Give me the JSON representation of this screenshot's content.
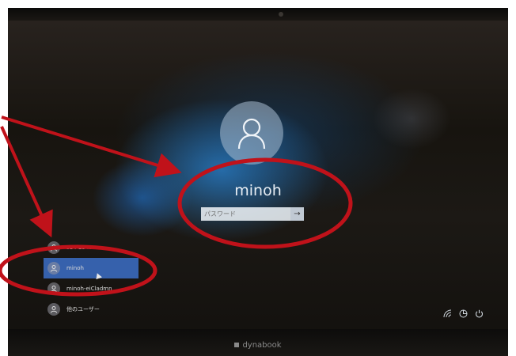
{
  "lock_screen": {
    "username": "minoh",
    "password_placeholder": "パスワード",
    "submit_icon": "arrow-right-icon",
    "avatar_icon": "user-silhouette-icon"
  },
  "user_list": [
    {
      "label": "s14-2345",
      "selected": false
    },
    {
      "label": "minoh",
      "selected": true
    },
    {
      "label": "minoh-eiCladmn",
      "selected": false
    },
    {
      "label": "他のユーザー",
      "selected": false
    }
  ],
  "system_icons": [
    "network-icon",
    "ease-of-access-icon",
    "power-icon"
  ],
  "device": {
    "brand": "dynabook"
  },
  "annotation_colors": {
    "circle": "#c0121a",
    "arrow": "#c0121a"
  }
}
